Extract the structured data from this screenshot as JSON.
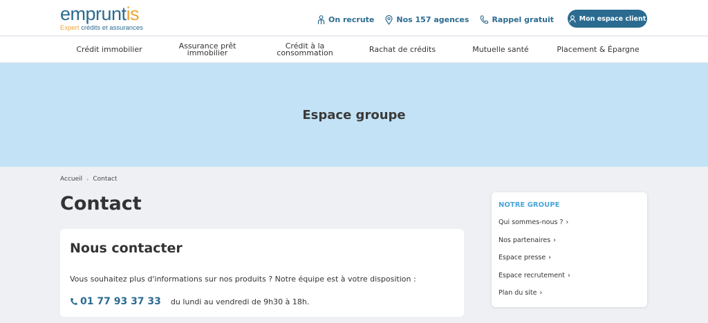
{
  "logo": {
    "main": "emprunt",
    "main_accent": "is",
    "sub_accent": "Expert",
    "sub": " crédits et assurances"
  },
  "header": {
    "links": [
      {
        "label": "On recrute",
        "icon": "person-icon"
      },
      {
        "label": "Nos 157 agences",
        "icon": "location-pin-icon"
      },
      {
        "label": "Rappel gratuit",
        "icon": "phone-icon"
      }
    ],
    "client_button": "Mon espace client"
  },
  "nav": {
    "items": [
      {
        "line1": "Crédit immobilier",
        "line2": ""
      },
      {
        "line1": "Assurance prêt",
        "line2": "immobilier"
      },
      {
        "line1": "Crédit à la",
        "line2": "consommation"
      },
      {
        "line1": "Rachat de crédits",
        "line2": ""
      },
      {
        "line1": "Mutuelle santé",
        "line2": ""
      },
      {
        "line1": "Placement & Épargne",
        "line2": ""
      }
    ]
  },
  "hero": {
    "title": "Espace groupe"
  },
  "breadcrumb": {
    "home": "Accueil",
    "separator": "›",
    "current": "Contact"
  },
  "page": {
    "title": "Contact"
  },
  "contact_card": {
    "title": "Nous contacter",
    "text": "Vous souhaitez plus d'informations sur nos produits ? Notre équipe est à votre disposition :",
    "phone": "01 77 93 37 33",
    "hours": "du lundi au vendredi de 9h30 à 18h."
  },
  "sidebar": {
    "title": "NOTRE GROUPE",
    "chevron": "›",
    "items": [
      "Qui sommes-nous ?",
      "Nos partenaires",
      "Espace presse",
      "Espace recrutement",
      "Plan du site"
    ]
  },
  "colors": {
    "brand": "#2b6b90",
    "accent": "#f0a433",
    "hero_bg": "#c3e2f5",
    "sidebar_title": "#4aa6d8"
  }
}
